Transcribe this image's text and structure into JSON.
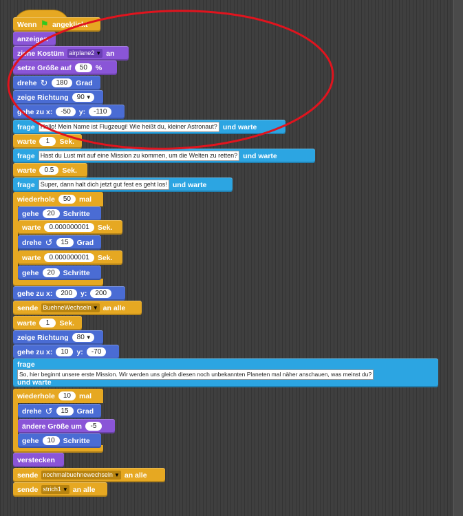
{
  "script": {
    "hat": {
      "pre": "Wenn",
      "post": "angeklickt",
      "icon": "green-flag-icon"
    },
    "show": "anzeigen",
    "costume": {
      "label": "ziehe Kostüm",
      "value": "airplane2",
      "post": "an"
    },
    "size": {
      "label": "setze Größe auf",
      "value": "50",
      "post": "%"
    },
    "turn1": {
      "label": "drehe",
      "icon": "rotate-clockwise-icon",
      "value": "180",
      "post": "Grad"
    },
    "dir1": {
      "label": "zeige Richtung",
      "value": "90"
    },
    "goto1": {
      "label": "gehe zu x:",
      "x": "-50",
      "ylabel": "y:",
      "y": "-110"
    },
    "ask1": {
      "label": "frage",
      "text": "Hallo! Mein Name ist Flugzeugi! Wie heißt du, kleiner Astronaut?",
      "post": "und warte"
    },
    "wait1": {
      "label": "warte",
      "value": "1",
      "post": "Sek."
    },
    "ask2": {
      "label": "frage",
      "text": "Hast du Lust mit auf eine Mission zu kommen, um die Welten zu retten?",
      "post": "und warte"
    },
    "wait2": {
      "label": "warte",
      "value": "0.5",
      "post": "Sek."
    },
    "ask3": {
      "label": "frage",
      "text": "Super, dann halt dich jetzt gut fest es geht los!",
      "post": "und warte"
    },
    "repeat1": {
      "label": "wiederhole",
      "value": "50",
      "post": "mal"
    },
    "move1": {
      "label": "gehe",
      "value": "20",
      "post": "Schritte"
    },
    "wait3": {
      "label": "warte",
      "value": "0.000000001",
      "post": "Sek."
    },
    "turn2": {
      "label": "drehe",
      "icon": "rotate-counterclockwise-icon",
      "value": "15",
      "post": "Grad"
    },
    "wait4": {
      "label": "warte",
      "value": "0.000000001",
      "post": "Sek."
    },
    "move2": {
      "label": "gehe",
      "value": "20",
      "post": "Schritte"
    },
    "goto2": {
      "label": "gehe zu x:",
      "x": "200",
      "ylabel": "y:",
      "y": "200"
    },
    "broadcast1": {
      "label": "sende",
      "value": "BuehneWechseln",
      "post": "an alle"
    },
    "wait5": {
      "label": "warte",
      "value": "1",
      "post": "Sek."
    },
    "dir2": {
      "label": "zeige Richtung",
      "value": "80"
    },
    "goto3": {
      "label": "gehe zu x:",
      "x": "10",
      "ylabel": "y:",
      "y": "-70"
    },
    "ask4": {
      "label": "frage",
      "text": "So, hier beginnt unsere erste Mission. Wir werden uns gleich diesen noch unbekannten Planeten mal näher anschauen, was meinst du?",
      "post": "und warte"
    },
    "repeat2": {
      "label": "wiederhole",
      "value": "10",
      "post": "mal"
    },
    "turn3": {
      "label": "drehe",
      "icon": "rotate-counterclockwise-icon",
      "value": "15",
      "post": "Grad"
    },
    "grow": {
      "label": "ändere Größe um",
      "value": "-5"
    },
    "move3": {
      "label": "gehe",
      "value": "10",
      "post": "Schritte"
    },
    "hide": "verstecken",
    "broadcast2": {
      "label": "sende",
      "value": "nochmalbuehnewechseln",
      "post": "an alle"
    },
    "broadcast3": {
      "label": "sende",
      "value": "strich1",
      "post": "an alle"
    }
  },
  "colors": {
    "control": "#e6a822",
    "looks": "#8a55d7",
    "motion": "#4a6cd4",
    "sensing": "#2ca5e2",
    "annotation": "#e0141e"
  }
}
